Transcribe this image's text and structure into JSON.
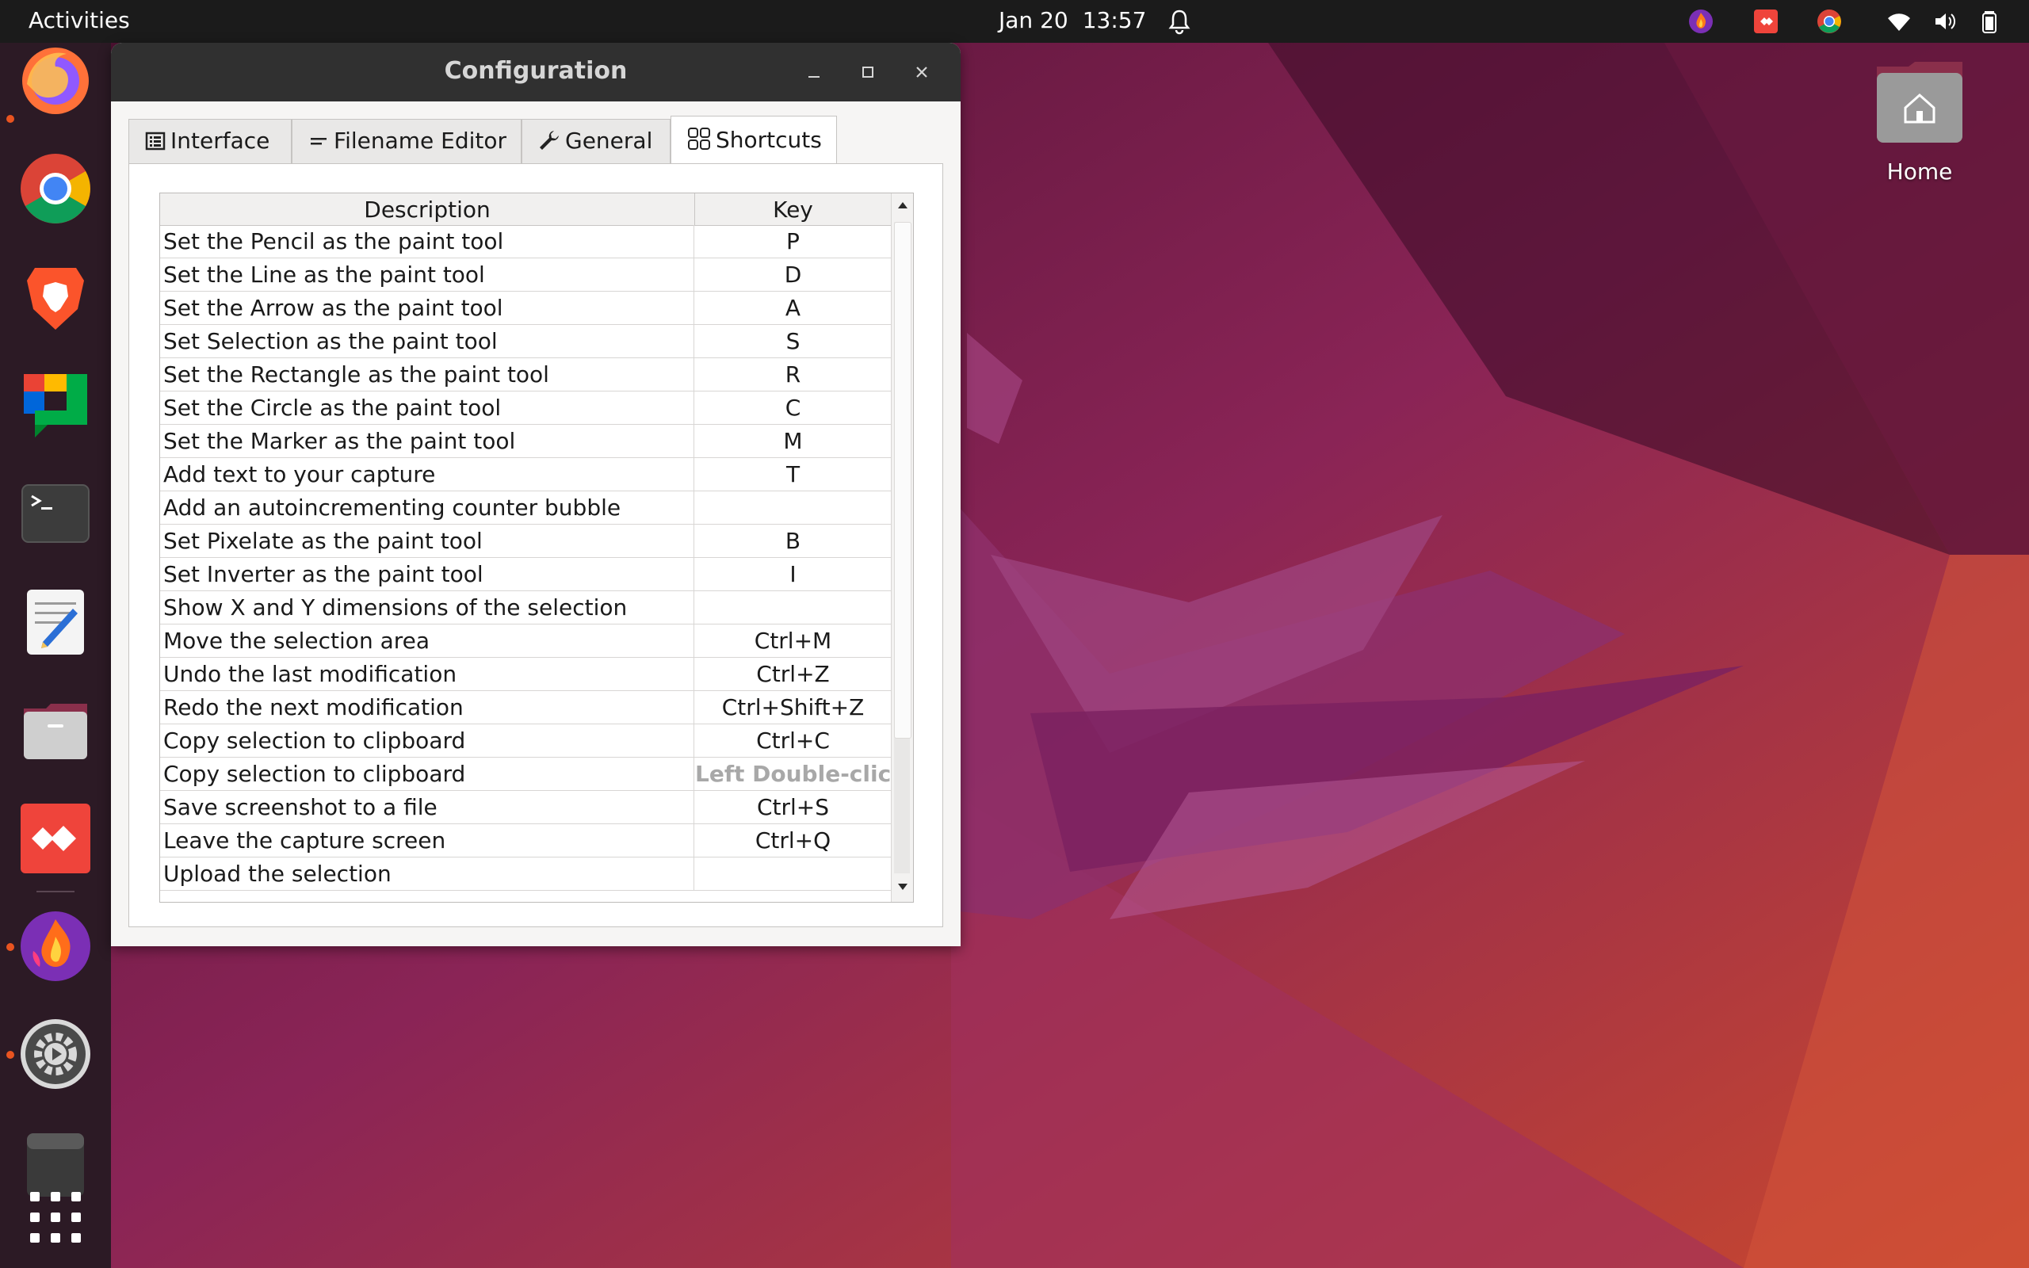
{
  "topbar": {
    "activities": "Activities",
    "date": "Jan 20",
    "time": "13:57",
    "icons": [
      "bell-icon",
      "flameshot-tray-icon",
      "anydesk-tray-icon",
      "chrome-tray-icon",
      "wifi-icon",
      "volume-icon",
      "battery-icon"
    ]
  },
  "dock": {
    "items": [
      "firefox-icon",
      "chrome-icon",
      "brave-icon",
      "google-chat-icon",
      "terminal-icon",
      "text-editor-icon",
      "files-icon",
      "anydesk-icon",
      "flameshot-icon",
      "settings-icon",
      "trash-icon",
      "app-grid-icon"
    ]
  },
  "desktop": {
    "home_label": "Home"
  },
  "window": {
    "title": "Configuration",
    "tabs": [
      {
        "label": "Interface"
      },
      {
        "label": "Filename Editor"
      },
      {
        "label": "General"
      },
      {
        "label": "Shortcuts"
      }
    ],
    "active_tab": "Shortcuts",
    "table": {
      "headers": [
        "Description",
        "Key"
      ],
      "rows": [
        {
          "desc": "Set the Pencil as the paint tool",
          "key": "P"
        },
        {
          "desc": "Set the Line as the paint tool",
          "key": "D"
        },
        {
          "desc": "Set the Arrow as the paint tool",
          "key": "A"
        },
        {
          "desc": "Set Selection as the paint tool",
          "key": "S"
        },
        {
          "desc": "Set the Rectangle as the paint tool",
          "key": "R"
        },
        {
          "desc": "Set the Circle as the paint tool",
          "key": "C"
        },
        {
          "desc": "Set the Marker as the paint tool",
          "key": "M"
        },
        {
          "desc": "Add text to your capture",
          "key": "T"
        },
        {
          "desc": "Add an autoincrementing counter bubble",
          "key": ""
        },
        {
          "desc": "Set Pixelate as the paint tool",
          "key": "B"
        },
        {
          "desc": "Set Inverter as the paint tool",
          "key": "I"
        },
        {
          "desc": "Show X and Y dimensions of the selection",
          "key": ""
        },
        {
          "desc": "Move the selection area",
          "key": "Ctrl+M"
        },
        {
          "desc": "Undo the last modification",
          "key": "Ctrl+Z"
        },
        {
          "desc": "Redo the next modification",
          "key": "Ctrl+Shift+Z"
        },
        {
          "desc": "Copy selection to clipboard",
          "key": "Ctrl+C"
        },
        {
          "desc": "Copy selection to clipboard",
          "key": "Left Double-click",
          "muted": true
        },
        {
          "desc": "Save screenshot to a file",
          "key": "Ctrl+S"
        },
        {
          "desc": "Leave the capture screen",
          "key": "Ctrl+Q"
        },
        {
          "desc": "Upload the selection",
          "key": ""
        }
      ]
    }
  },
  "colors": {
    "accent": "#e95420",
    "topbar": "#1b1b1b",
    "titlebar": "#303030"
  }
}
